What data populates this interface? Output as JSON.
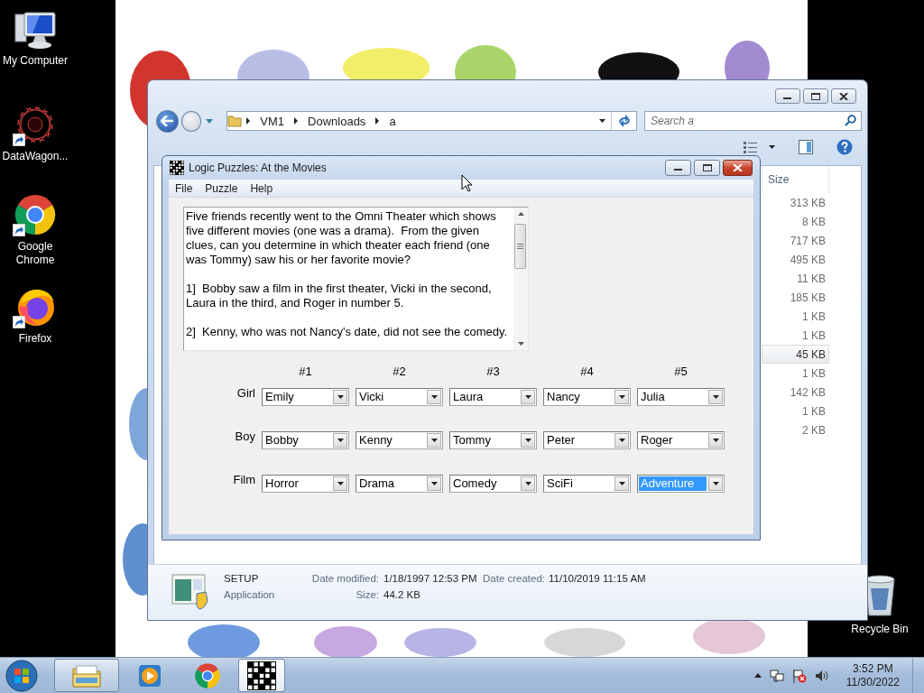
{
  "desktop_icons": [
    {
      "kind": "computer",
      "label": "My Computer",
      "shortcut": false
    },
    {
      "kind": "starburst",
      "label": "DataWagon...",
      "shortcut": true
    },
    {
      "kind": "chrome",
      "label": "Google Chrome",
      "shortcut": true
    },
    {
      "kind": "firefox",
      "label": "Firefox",
      "shortcut": true
    },
    {
      "kind": "recycle_bin",
      "label": "Recycle Bin",
      "shortcut": false
    }
  ],
  "explorer": {
    "breadcrumb": [
      "VM1",
      "Downloads",
      "a"
    ],
    "search": {
      "placeholder": "Search a"
    },
    "file_list": {
      "column": "Size",
      "rows": [
        {
          "size": "313 KB",
          "selected": false
        },
        {
          "size": "8 KB",
          "selected": false
        },
        {
          "size": "717 KB",
          "selected": false
        },
        {
          "size": "495 KB",
          "selected": false
        },
        {
          "size": "11 KB",
          "selected": false
        },
        {
          "size": "185 KB",
          "selected": false
        },
        {
          "size": "1 KB",
          "selected": false
        },
        {
          "size": "1 KB",
          "selected": false
        },
        {
          "size": "45 KB",
          "selected": true
        },
        {
          "size": "1 KB",
          "selected": false
        },
        {
          "size": "142 KB",
          "selected": false
        },
        {
          "size": "1 KB",
          "selected": false
        },
        {
          "size": "2 KB",
          "selected": false
        }
      ]
    },
    "details": {
      "name": "SETUP",
      "type": "Application",
      "modified_label": "Date modified:",
      "modified": "1/18/1997 12:53 PM",
      "created_label": "Date created:",
      "created": "11/10/2019 11:15 AM",
      "size_label": "Size:",
      "size": "44.2 KB"
    }
  },
  "puzzle": {
    "title": "Logic Puzzles: At the Movies",
    "menu": [
      "File",
      "Puzzle",
      "Help"
    ],
    "clues": [
      "Five friends recently went to the Omni Theater which shows five different movies (one was a drama).  From the given clues, can you determine in which theater each friend (one was Tommy) saw his or her favorite movie?",
      "1]  Bobby saw a film in the first theater, Vicki in the second, Laura in the third, and Roger in number 5.",
      "2]  Kenny, who was not Nancy's date, did not see the comedy."
    ],
    "columns": [
      "#1",
      "#2",
      "#3",
      "#4",
      "#5"
    ],
    "rows": [
      {
        "label": "Girl",
        "cells": [
          {
            "value": "Emily",
            "selected": false
          },
          {
            "value": "Vicki",
            "selected": false
          },
          {
            "value": "Laura",
            "selected": false
          },
          {
            "value": "Nancy",
            "selected": false
          },
          {
            "value": "Julia",
            "selected": false
          }
        ]
      },
      {
        "label": "Boy",
        "cells": [
          {
            "value": "Bobby",
            "selected": false
          },
          {
            "value": "Kenny",
            "selected": false
          },
          {
            "value": "Tommy",
            "selected": false
          },
          {
            "value": "Peter",
            "selected": false
          },
          {
            "value": "Roger",
            "selected": false
          }
        ]
      },
      {
        "label": "Film",
        "cells": [
          {
            "value": "Horror",
            "selected": false
          },
          {
            "value": "Drama",
            "selected": false
          },
          {
            "value": "Comedy",
            "selected": false
          },
          {
            "value": "SciFi",
            "selected": false
          },
          {
            "value": "Adventure",
            "selected": true
          }
        ]
      }
    ]
  },
  "taskbar": {
    "apps": [
      {
        "kind": "explorer",
        "running": true,
        "selected": false
      },
      {
        "kind": "media_player",
        "running": false,
        "selected": false
      },
      {
        "kind": "chrome",
        "running": false,
        "selected": false
      },
      {
        "kind": "puzzle",
        "running": true,
        "selected": true
      }
    ],
    "time": "3:52 PM",
    "date": "11/30/2022"
  }
}
